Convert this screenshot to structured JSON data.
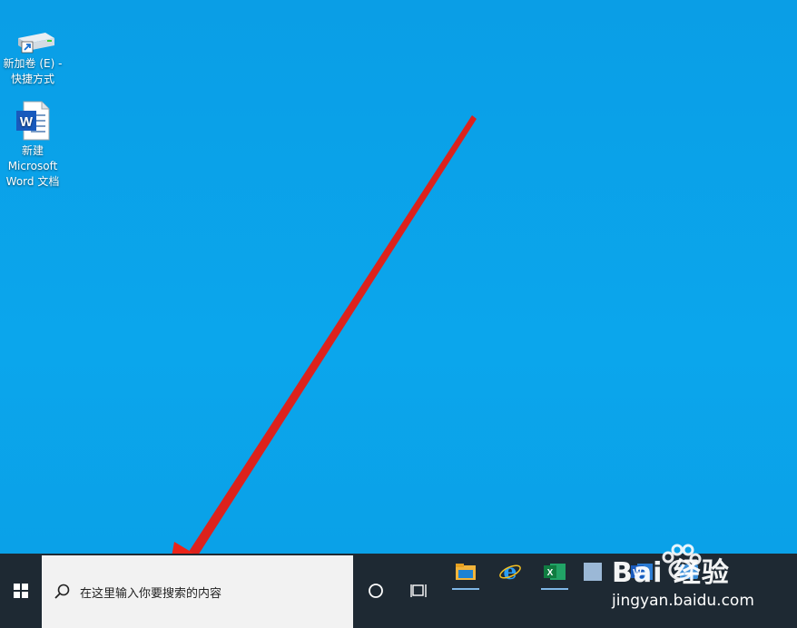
{
  "desktop": {
    "icons": [
      {
        "label": "新加卷 (E) -\n快捷方式"
      },
      {
        "label": "新建\nMicrosoft\nWord 文档"
      }
    ]
  },
  "taskbar": {
    "search_placeholder": "在这里输入你要搜索的内容"
  },
  "watermark": {
    "brand": "Bai 经验",
    "url": "jingyan.baidu.com"
  },
  "colors": {
    "desktop_bg": "#0a9fe6",
    "taskbar_bg": "#1e2933",
    "search_bg": "#f2f2f2",
    "arrow": "#e8211c"
  }
}
